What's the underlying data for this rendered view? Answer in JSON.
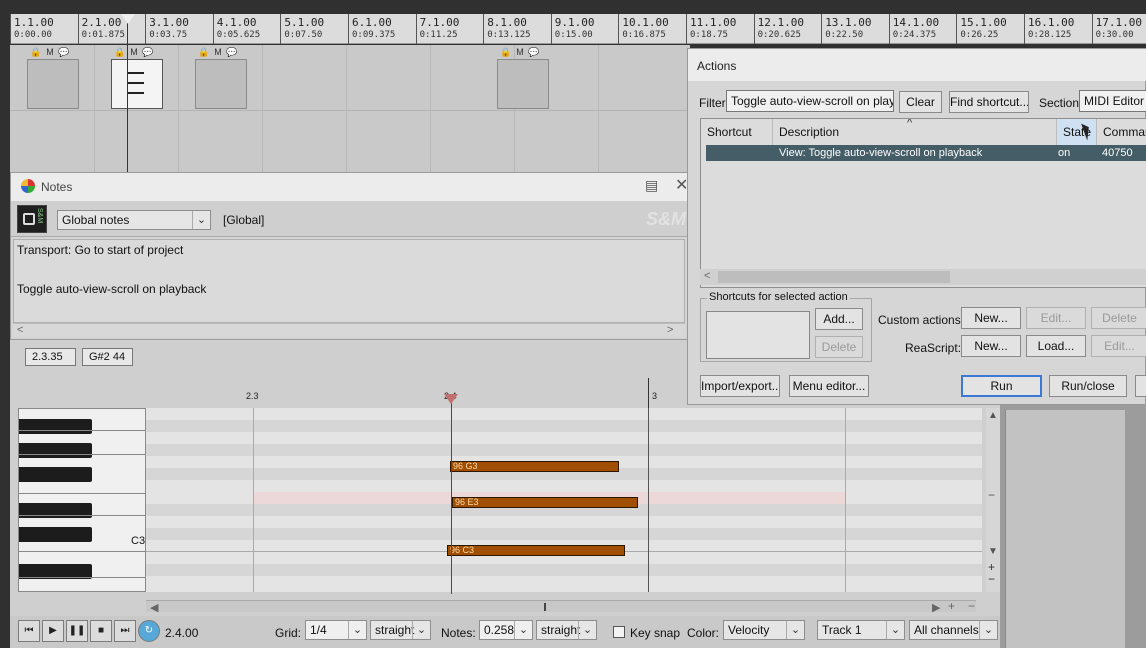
{
  "ruler": {
    "measures": [
      "1.1.00",
      "2.1.00",
      "3.1.00",
      "4.1.00",
      "5.1.00",
      "6.1.00",
      "7.1.00",
      "8.1.00",
      "9.1.00",
      "10.1.00",
      "11.1.00",
      "12.1.00",
      "13.1.00",
      "14.1.00",
      "15.1.00",
      "16.1.00",
      "17.1.00"
    ],
    "times": [
      "0:00.00",
      "0:01.875",
      "0:03.75",
      "0:05.625",
      "0:07.50",
      "0:09.375",
      "0:11.25",
      "0:13.125",
      "0:15.00",
      "0:16.875",
      "0:18.75",
      "0:20.625",
      "0:22.50",
      "0:24.375",
      "0:26.25",
      "0:28.125",
      "0:30.00"
    ]
  },
  "items": {
    "buttons": [
      "M",
      "M",
      "M",
      "M",
      "M"
    ]
  },
  "notes": {
    "title": "Notes",
    "lock_badge": "S&M",
    "notes_type": "Global notes",
    "scope": "[Global]",
    "brand": "S&M",
    "lines": [
      "Transport: Go to start of project",
      "Toggle auto-view-scroll on playback"
    ]
  },
  "midi": {
    "position": "2.3.35",
    "pitch": "G#2  44",
    "bars": [
      "2.3",
      "2.4",
      "3"
    ],
    "key_label": "C3",
    "notes": [
      {
        "label": "96  G3",
        "pitch": "G3",
        "start": 2.4,
        "length": 0.2
      },
      {
        "label": "96  E3",
        "pitch": "E3",
        "start": 2.4,
        "length": 0.22
      },
      {
        "label": "96  C3",
        "pitch": "C3",
        "start": 2.4,
        "length": 0.21
      }
    ],
    "transport_position": "2.4.00",
    "grid_label": "Grid:",
    "grid_value": "1/4",
    "grid_mode": "straight",
    "notes_label": "Notes:",
    "notes_value": "0.258",
    "notes_mode": "straight",
    "keysnap_label": "Key snap",
    "color_label": "Color:",
    "color_value": "Velocity",
    "track_value": "Track 1",
    "channel_value": "All channels"
  },
  "actions": {
    "title": "Actions",
    "filter_label": "Filter:",
    "filter_value": "Toggle auto-view-scroll on playbac",
    "clear": "Clear",
    "find_shortcut": "Find shortcut...",
    "section_label": "Section:",
    "section_value": "MIDI Editor",
    "columns": [
      "Shortcut",
      "Description",
      "State",
      "Command"
    ],
    "row": {
      "shortcut": "",
      "description": "View: Toggle auto-view-scroll on playback",
      "state": "on",
      "command": "40750"
    },
    "shortcuts_group": "Shortcuts for selected action",
    "add": "Add...",
    "delete": "Delete",
    "custom_actions_label": "Custom actions:",
    "new": "New...",
    "edit": "Edit...",
    "reascript_label": "ReaScript:",
    "load": "Load...",
    "import_export": "Import/export...",
    "menu_editor": "Menu editor...",
    "run": "Run",
    "run_close": "Run/close"
  }
}
